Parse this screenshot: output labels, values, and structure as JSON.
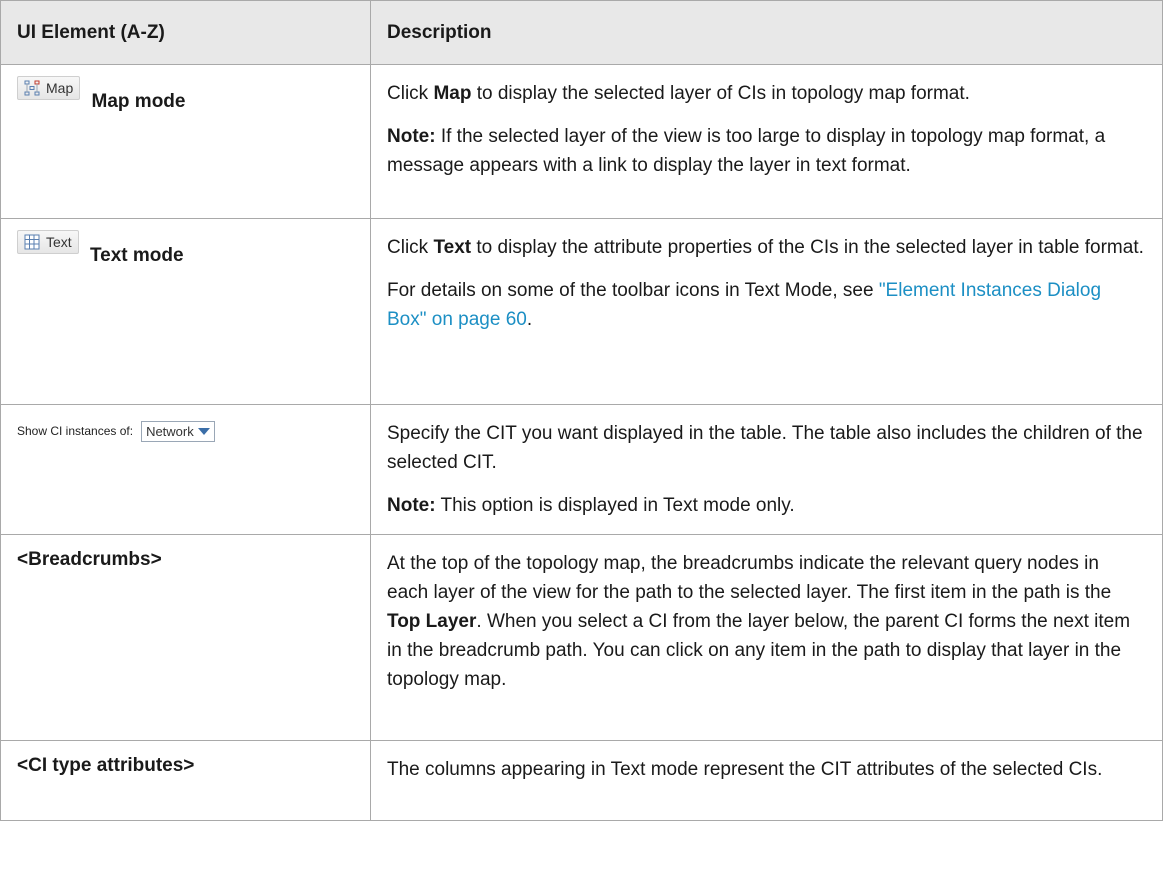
{
  "header": {
    "col1": "UI Element (A-Z)",
    "col2": "Description"
  },
  "rows": {
    "map": {
      "button_label": "Map",
      "name": "Map mode",
      "desc_pre": "Click ",
      "desc_bold": "Map",
      "desc_post": " to display the selected layer of CIs in topology map format.",
      "note_label": "Note:",
      "note_text": " If the selected layer of the view is too large to display in topology map format, a message appears with a link to display the layer in text format."
    },
    "text": {
      "button_label": "Text",
      "name": "Text mode",
      "desc_pre": "Click ",
      "desc_bold": "Text",
      "desc_post": " to display the attribute properties of the CIs in the selected layer in table format.",
      "details_pre": "For details on some of the toolbar icons in Text Mode, see ",
      "details_link": "\"Element Instances Dialog Box\" on page 60",
      "details_post": "."
    },
    "showci": {
      "label": "Show CI instances of:",
      "select_value": "Network",
      "desc": "Specify the CIT you want displayed in the table. The table also includes the children of the selected CIT.",
      "note_label": "Note:",
      "note_text": " This option is displayed in Text mode only."
    },
    "breadcrumbs": {
      "name": "<Breadcrumbs>",
      "desc_pre": "At the top of the topology map, the breadcrumbs indicate the relevant query nodes in each layer of the view for the path to the selected layer. The first item in the path is the ",
      "desc_bold": "Top Layer",
      "desc_post": ". When you select a CI from the layer below, the parent CI forms the next item in the breadcrumb path. You can click on any item in the path to display that layer in the topology map."
    },
    "citype": {
      "name": "<CI type attributes>",
      "desc": "The columns appearing in Text mode represent the CIT attributes of the selected CIs."
    }
  },
  "colors": {
    "header_bg": "#e8e8e8",
    "border": "#a9a9a9",
    "link": "#1c8fc4"
  }
}
